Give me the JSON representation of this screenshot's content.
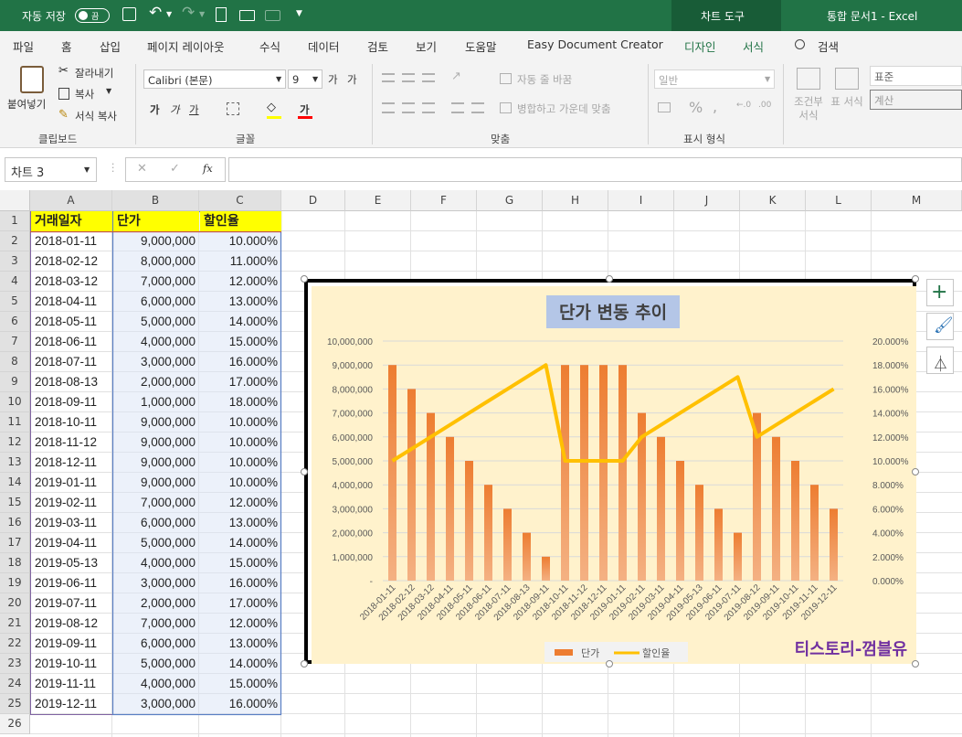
{
  "title_bar": {
    "autosave": "자동 저장",
    "toggle": "끔",
    "chart_tools": "차트 도구",
    "doc_title": "통합 문서1  -  Excel"
  },
  "tabs": [
    "파일",
    "홈",
    "삽입",
    "페이지 레이아웃",
    "수식",
    "데이터",
    "검토",
    "보기",
    "도움말",
    "Easy Document Creator",
    "디자인",
    "서식",
    "검색"
  ],
  "ribbon": {
    "paste": "붙여넣기",
    "cut": "잘라내기",
    "copy": "복사",
    "format_copy": "서식 복사",
    "clipboard": "클립보드",
    "font_name": "Calibri (본문)",
    "font_size": "9",
    "font_group": "글꼴",
    "wrap": "자동 줄 바꿈",
    "merge": "병합하고 가운데 맞춤",
    "align_group": "맞춤",
    "num_format": "일반",
    "num_group": "표시 형식",
    "cond": "조건부 서식",
    "table": "표 서식",
    "style_normal": "표준",
    "style_calc": "계산",
    "bold": "가",
    "italic": "가",
    "underline": "가",
    "font_grow": "가",
    "font_shrink": "가",
    "font_color": "가"
  },
  "formula_bar": {
    "name_box": "차트 3",
    "fx": "fx",
    "cancel": "✕",
    "enter": "✓",
    "value": ""
  },
  "columns": [
    "A",
    "B",
    "C",
    "D",
    "E",
    "F",
    "G",
    "H",
    "I",
    "J",
    "K",
    "L",
    "M"
  ],
  "headers": [
    "거래일자",
    "단가",
    "할인율"
  ],
  "rows": [
    [
      "2018-01-11",
      "9,000,000",
      "10.000%"
    ],
    [
      "2018-02-12",
      "8,000,000",
      "11.000%"
    ],
    [
      "2018-03-12",
      "7,000,000",
      "12.000%"
    ],
    [
      "2018-04-11",
      "6,000,000",
      "13.000%"
    ],
    [
      "2018-05-11",
      "5,000,000",
      "14.000%"
    ],
    [
      "2018-06-11",
      "4,000,000",
      "15.000%"
    ],
    [
      "2018-07-11",
      "3,000,000",
      "16.000%"
    ],
    [
      "2018-08-13",
      "2,000,000",
      "17.000%"
    ],
    [
      "2018-09-11",
      "1,000,000",
      "18.000%"
    ],
    [
      "2018-10-11",
      "9,000,000",
      "10.000%"
    ],
    [
      "2018-11-12",
      "9,000,000",
      "10.000%"
    ],
    [
      "2018-12-11",
      "9,000,000",
      "10.000%"
    ],
    [
      "2019-01-11",
      "9,000,000",
      "10.000%"
    ],
    [
      "2019-02-11",
      "7,000,000",
      "12.000%"
    ],
    [
      "2019-03-11",
      "6,000,000",
      "13.000%"
    ],
    [
      "2019-04-11",
      "5,000,000",
      "14.000%"
    ],
    [
      "2019-05-13",
      "4,000,000",
      "15.000%"
    ],
    [
      "2019-06-11",
      "3,000,000",
      "16.000%"
    ],
    [
      "2019-07-11",
      "2,000,000",
      "17.000%"
    ],
    [
      "2019-08-12",
      "7,000,000",
      "12.000%"
    ],
    [
      "2019-09-11",
      "6,000,000",
      "13.000%"
    ],
    [
      "2019-10-11",
      "5,000,000",
      "14.000%"
    ],
    [
      "2019-11-11",
      "4,000,000",
      "15.000%"
    ],
    [
      "2019-12-11",
      "3,000,000",
      "16.000%"
    ]
  ],
  "colors": {
    "excel_green": "#217346",
    "bar": "#ed7d31",
    "line": "#ffc000",
    "plot_bg": "#fff2cc",
    "title_bg": "#b4c6e7",
    "watermark": "#7030a0",
    "header_fill": "#ffff00"
  },
  "watermark": "티스토리-껌블유",
  "chart_data": {
    "type": "bar+line",
    "title": "단가 변동 추이",
    "categories": [
      "2018-01-11",
      "2018-02-12",
      "2018-03-12",
      "2018-04-11",
      "2018-05-11",
      "2018-06-11",
      "2018-07-11",
      "2018-08-13",
      "2018-09-11",
      "2018-10-11",
      "2018-11-12",
      "2018-12-11",
      "2019-01-11",
      "2019-02-11",
      "2019-03-11",
      "2019-04-11",
      "2019-05-13",
      "2019-06-11",
      "2019-07-11",
      "2019-08-12",
      "2019-09-11",
      "2019-10-11",
      "2019-11-11",
      "2019-12-11"
    ],
    "series": [
      {
        "name": "단가",
        "type": "bar",
        "axis": "left",
        "values": [
          9000000,
          8000000,
          7000000,
          6000000,
          5000000,
          4000000,
          3000000,
          2000000,
          1000000,
          9000000,
          9000000,
          9000000,
          9000000,
          7000000,
          6000000,
          5000000,
          4000000,
          3000000,
          2000000,
          7000000,
          6000000,
          5000000,
          4000000,
          3000000
        ]
      },
      {
        "name": "할인율",
        "type": "line",
        "axis": "right",
        "values": [
          10,
          11,
          12,
          13,
          14,
          15,
          16,
          17,
          18,
          10,
          10,
          10,
          10,
          12,
          13,
          14,
          15,
          16,
          17,
          12,
          13,
          14,
          15,
          16
        ]
      }
    ],
    "ylim": [
      0,
      10000000
    ],
    "y2lim": [
      0,
      20
    ],
    "y_ticks": [
      "-",
      "1,000,000",
      "2,000,000",
      "3,000,000",
      "4,000,000",
      "5,000,000",
      "6,000,000",
      "7,000,000",
      "8,000,000",
      "9,000,000",
      "10,000,000"
    ],
    "y2_ticks": [
      "0.000%",
      "2.000%",
      "4.000%",
      "6.000%",
      "8.000%",
      "10.000%",
      "12.000%",
      "14.000%",
      "16.000%",
      "18.000%",
      "20.000%"
    ],
    "legend_position": "bottom",
    "grid": true
  }
}
